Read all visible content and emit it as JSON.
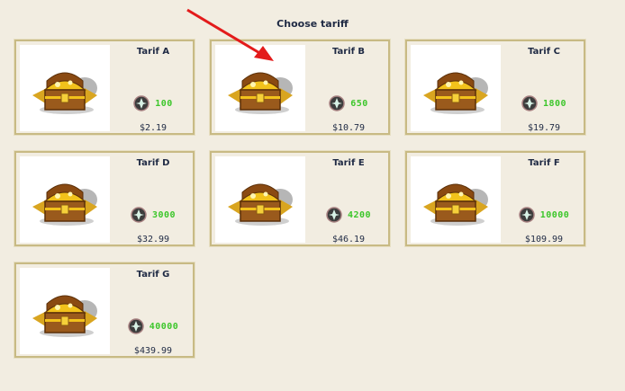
{
  "page": {
    "title": "Choose tariff"
  },
  "tariffs": [
    {
      "name": "Tarif A",
      "coins": "100",
      "price": "$2.19"
    },
    {
      "name": "Tarif B",
      "coins": "650",
      "price": "$10.79"
    },
    {
      "name": "Tarif C",
      "coins": "1800",
      "price": "$19.79"
    },
    {
      "name": "Tarif D",
      "coins": "3000",
      "price": "$32.99"
    },
    {
      "name": "Tarif E",
      "coins": "4200",
      "price": "$46.19"
    },
    {
      "name": "Tarif F",
      "coins": "10000",
      "price": "$109.99"
    },
    {
      "name": "Tarif G",
      "coins": "40000",
      "price": "$439.99"
    }
  ],
  "icons": {
    "chest": "treasure-chest-icon",
    "currency": "gem-coin-icon",
    "annotation": "red-arrow"
  },
  "colors": {
    "coin_amount": "#3cc62a",
    "arrow": "#e31b1b",
    "card_border": "#c8ba84"
  }
}
